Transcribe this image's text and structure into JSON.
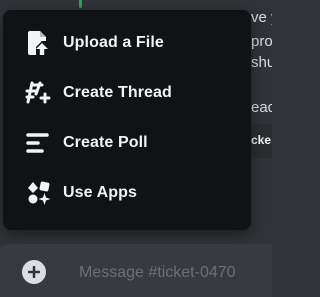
{
  "background": {
    "line1": "ve y",
    "line2": "pro",
    "line3": "shu",
    "line4": "eac",
    "embed_text": "cke"
  },
  "menu": {
    "items": [
      {
        "label": "Upload a File",
        "icon": "upload-file-icon"
      },
      {
        "label": "Create Thread",
        "icon": "thread-icon"
      },
      {
        "label": "Create Poll",
        "icon": "poll-icon"
      },
      {
        "label": "Use Apps",
        "icon": "apps-icon"
      }
    ]
  },
  "composer": {
    "placeholder": "Message #ticket-0470",
    "value": ""
  },
  "colors": {
    "accent_green": "#23a559",
    "popover_bg": "#111214",
    "text": "#f2f3f5",
    "placeholder": "#6d6f78"
  }
}
